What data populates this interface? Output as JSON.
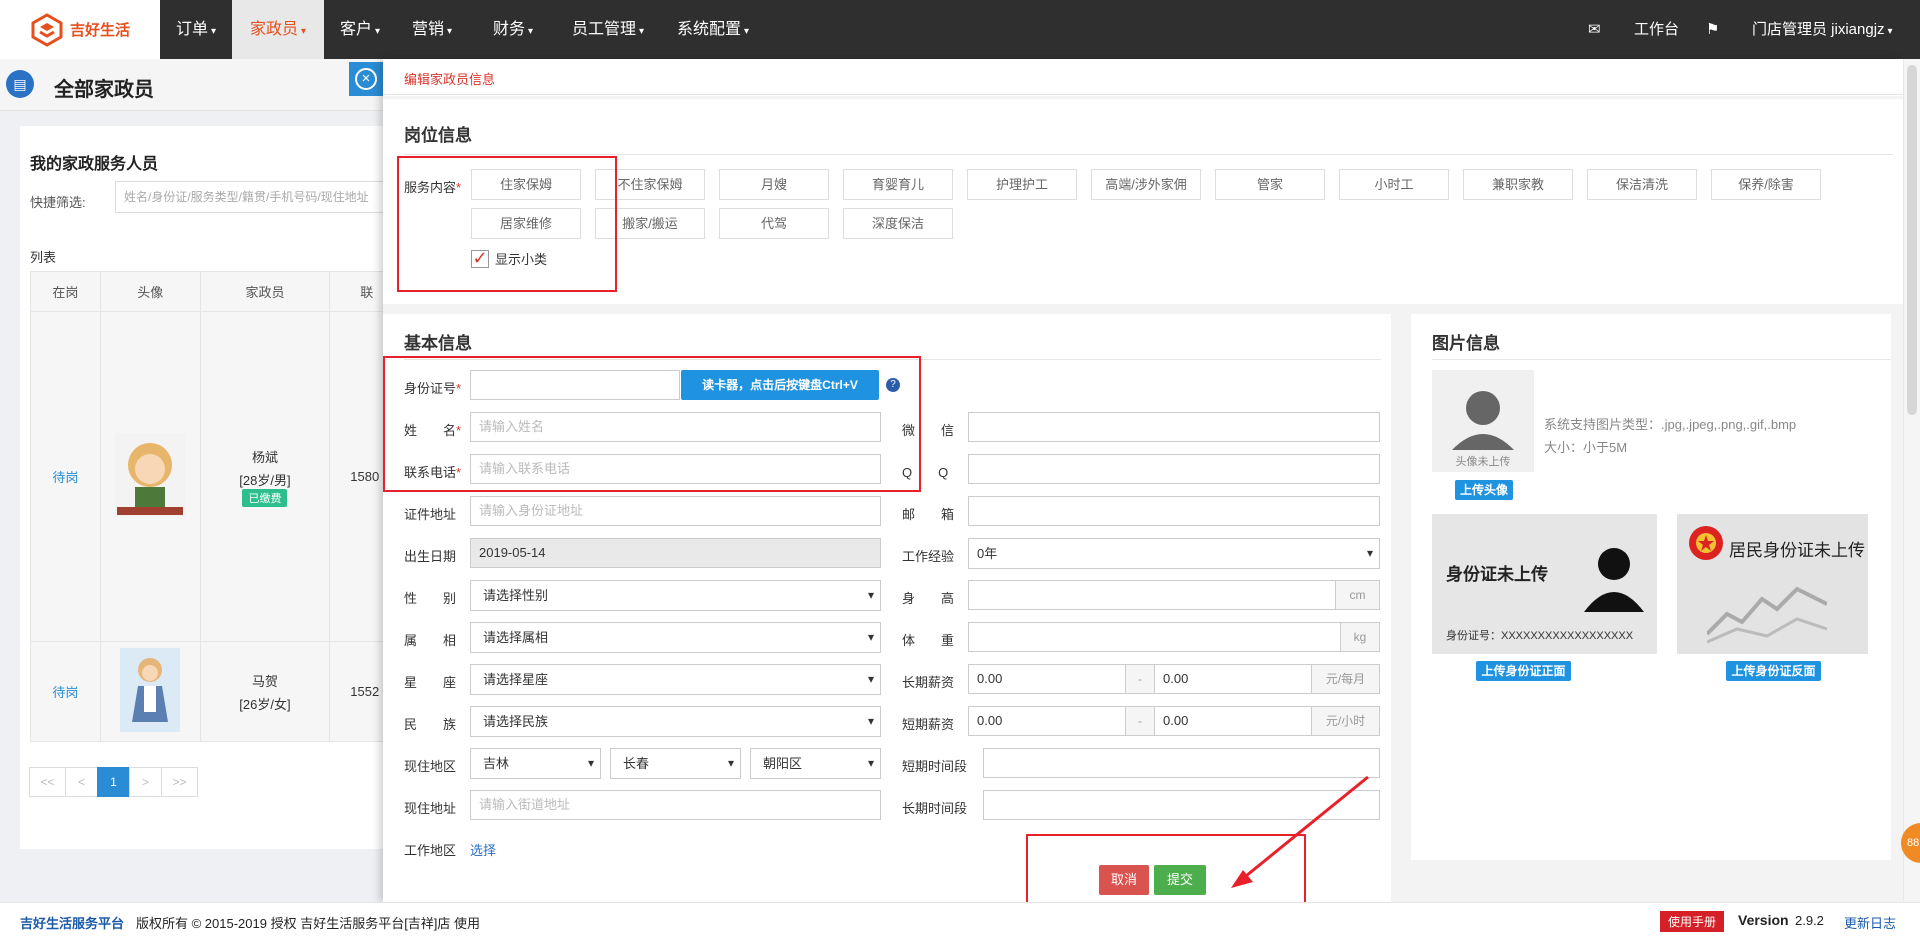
{
  "app": {
    "logo_text": "吉好生活",
    "accent": "#e5501f"
  },
  "nav": {
    "items": [
      {
        "label": "订单"
      },
      {
        "label": "家政员"
      },
      {
        "label": "客户"
      },
      {
        "label": "营销"
      },
      {
        "label": "财务"
      },
      {
        "label": "员工管理"
      },
      {
        "label": "系统配置"
      }
    ],
    "workbench": "工作台",
    "user": "门店管理员  jixiangjz"
  },
  "left": {
    "title": "全部家政员",
    "card_title": "我的家政服务人员",
    "filter_label": "快捷筛选:",
    "filter_placeholder": "姓名/身份证/服务类型/籍贯/手机号码/现住地址",
    "list_label": "列表",
    "columns": [
      "在岗",
      "头像",
      "家政员",
      "联"
    ],
    "rows": [
      {
        "status": "待岗",
        "name": "杨斌",
        "info": "[28岁/男]",
        "badge": "已缴费",
        "phone": "1580"
      },
      {
        "status": "待岗",
        "name": "马贺",
        "info": "[26岁/女]",
        "badge": "",
        "phone": "1552"
      }
    ],
    "pager": [
      "<<",
      "<",
      "1",
      ">",
      ">>"
    ]
  },
  "modal": {
    "header": "编辑家政员信息",
    "position_title": "岗位信息",
    "service_label": "服务内容",
    "services": [
      "住家保姆",
      "不住家保姆",
      "月嫂",
      "育婴育儿",
      "护理护工",
      "高端/涉外家佣",
      "管家",
      "小时工",
      "兼职家教",
      "保洁清洗",
      "保养/除害",
      "居家维修",
      "搬家/搬运",
      "代驾",
      "深度保洁"
    ],
    "show_sub": "显示小类",
    "basic_title": "基本信息",
    "image_title": "图片信息",
    "fields": {
      "id_card": "身份证号",
      "read_card_btn": "读卡器，点击后按键盘Ctrl+V",
      "name": "姓　　名",
      "name_ph": "请输入姓名",
      "phone": "联系电话",
      "phone_ph": "请输入联系电话",
      "id_addr": "证件地址",
      "id_addr_ph": "请输入身份证地址",
      "birth": "出生日期",
      "birth_val": "2019-05-14",
      "gender": "性　　别",
      "gender_val": "请选择性别",
      "zodiac": "属　　相",
      "zodiac_val": "请选择属相",
      "star": "星　　座",
      "star_val": "请选择星座",
      "nation": "民　　族",
      "nation_val": "请选择民族",
      "region": "现住地区",
      "province": "吉林",
      "city": "长春",
      "district": "朝阳区",
      "address": "现住地址",
      "address_ph": "请输入街道地址",
      "work_area": "工作地区",
      "work_area_link": "选择",
      "wechat": "微　　信",
      "qq": "Q　　Q",
      "email": "邮　　箱",
      "experience": "工作经验",
      "experience_val": "0年",
      "height": "身　　高",
      "height_unit": "cm",
      "weight": "体　　重",
      "weight_unit": "kg",
      "long_salary": "长期薪资",
      "long_min": "0.00",
      "long_max": "0.00",
      "long_unit": "元/每月",
      "short_salary": "短期薪资",
      "short_min": "0.00",
      "short_max": "0.00",
      "short_unit": "元/小时",
      "dash": "-",
      "short_period": "短期时间段",
      "long_period": "长期时间段"
    },
    "images": {
      "avatar_caption": "头像未上传",
      "support": "系统支持图片类型：.jpg,.jpeg,.png,.gif,.bmp",
      "size": "大小：小于5M",
      "upload_avatar": "上传头像",
      "id_front_title": "身份证未上传",
      "id_front_no": "身份证号：XXXXXXXXXXXXXXXXXX",
      "id_back_title": "居民身份证未上传",
      "upload_front": "上传身份证正面",
      "upload_back": "上传身份证反面"
    },
    "cancel": "取消",
    "submit": "提交"
  },
  "footer": {
    "brand": "吉好生活服务平台",
    "copyright": "版权所有 © 2015-2019 授权 吉好生活服务平台[吉祥]店 使用",
    "manual": "使用手册",
    "version_label": "Version",
    "version": "2.9.2",
    "changelog": "更新日志"
  },
  "float_badge": "88"
}
